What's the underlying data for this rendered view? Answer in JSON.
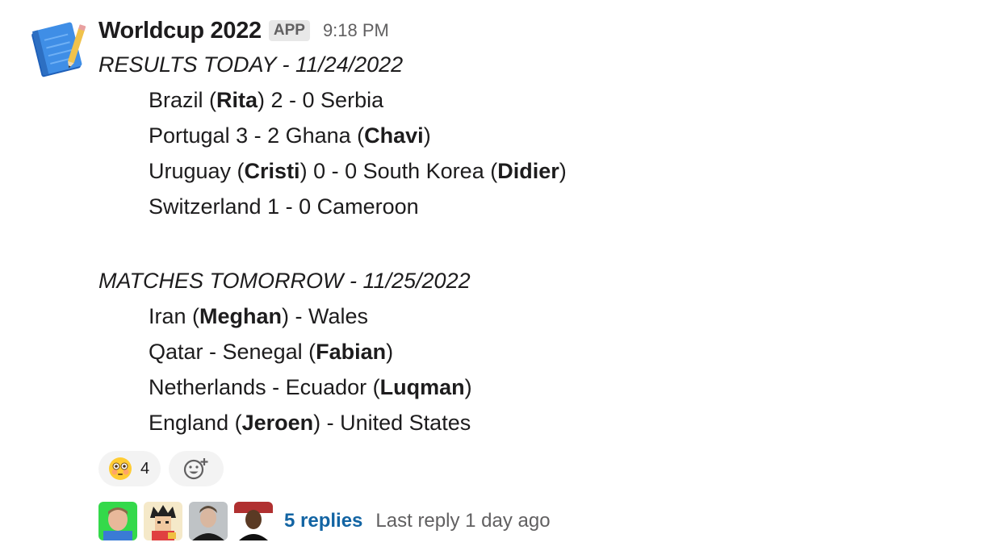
{
  "message": {
    "sender": "Worldcup 2022",
    "badge": "APP",
    "time": "9:18 PM",
    "icon": "notebook-icon"
  },
  "results": {
    "heading": "RESULTS TODAY - 11/24/2022",
    "matches": [
      {
        "pre": "Brazil (",
        "bold1": "Rita",
        "mid": ") 2 - 0 Serbia",
        "bold2": "",
        "post": ""
      },
      {
        "pre": "Portugal 3 - 2 Ghana (",
        "bold1": "Chavi",
        "mid": ")",
        "bold2": "",
        "post": ""
      },
      {
        "pre": "Uruguay (",
        "bold1": "Cristi",
        "mid": ") 0 - 0 South Korea (",
        "bold2": "Didier",
        "post": ")"
      },
      {
        "pre": "Switzerland 1 - 0 Cameroon",
        "bold1": "",
        "mid": "",
        "bold2": "",
        "post": ""
      }
    ]
  },
  "tomorrow": {
    "heading": "MATCHES TOMORROW - 11/25/2022",
    "matches": [
      {
        "pre": "Iran (",
        "bold1": "Meghan",
        "mid": ") - Wales"
      },
      {
        "pre": "Qatar - Senegal (",
        "bold1": "Fabian",
        "mid": ")"
      },
      {
        "pre": "Netherlands - Ecuador (",
        "bold1": "Luqman",
        "mid": ")"
      },
      {
        "pre": "England (",
        "bold1": "Jeroen",
        "mid": ") - United States"
      }
    ]
  },
  "reactions": {
    "emoji": "flushed-face-icon",
    "count": "4",
    "add_icon": "add-reaction-icon"
  },
  "thread": {
    "replies": "5 replies",
    "last_reply": "Last reply 1 day ago"
  },
  "colors": {
    "link": "#1264a3",
    "muted": "#616061",
    "pill": "#f3f3f3"
  }
}
